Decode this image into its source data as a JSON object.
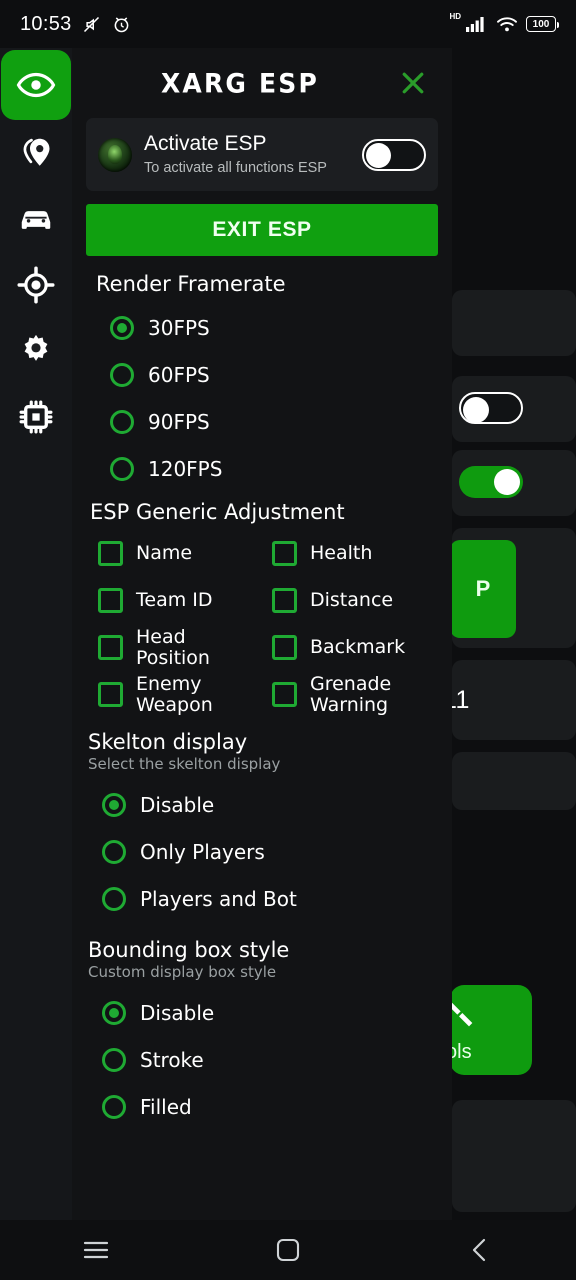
{
  "status_bar": {
    "clock": "10:53",
    "battery_percent": "100",
    "network_label": "HD",
    "wifi_gen": "6",
    "icons": [
      "mute-icon",
      "alarm-icon",
      "cellular-signal-icon",
      "wifi-icon",
      "battery-icon"
    ]
  },
  "header": {
    "title": "XARG ESP",
    "eye_icon": "eye-icon",
    "close_icon": "close-icon",
    "accent": "#10a010"
  },
  "sidebar": {
    "items": [
      {
        "name": "sidebar-item-location",
        "icon": "location-pin-icon"
      },
      {
        "name": "sidebar-item-vehicle",
        "icon": "car-icon"
      },
      {
        "name": "sidebar-item-aim",
        "icon": "crosshair-target-icon"
      },
      {
        "name": "sidebar-item-settings",
        "icon": "gear-icon"
      },
      {
        "name": "sidebar-item-memory",
        "icon": "cpu-chip-icon"
      }
    ]
  },
  "activate_card": {
    "title": "Activate ESP",
    "subtitle": "To activate all functions ESP",
    "toggle_state": "off",
    "avatar": "app-avatar-icon"
  },
  "exit_button": {
    "label": "EXIT ESP"
  },
  "render_framerate": {
    "heading": "Render Framerate",
    "options": [
      {
        "label": "30FPS",
        "selected": true
      },
      {
        "label": "60FPS",
        "selected": false
      },
      {
        "label": "90FPS",
        "selected": false
      },
      {
        "label": "120FPS",
        "selected": false
      }
    ]
  },
  "esp_generic_adjustment": {
    "heading": "ESP Generic Adjustment",
    "checkboxes": [
      {
        "label": "Name",
        "checked": false
      },
      {
        "label": "Health",
        "checked": false
      },
      {
        "label": "Team ID",
        "checked": false
      },
      {
        "label": "Distance",
        "checked": false
      },
      {
        "label": "Head Position",
        "checked": false
      },
      {
        "label": "Backmark",
        "checked": false
      },
      {
        "label": "Enemy Weapon",
        "checked": false
      },
      {
        "label": "Grenade Warning",
        "checked": false
      }
    ]
  },
  "skelton_display": {
    "heading": "Skelton display",
    "subtitle": "Select the skelton display",
    "options": [
      {
        "label": "Disable",
        "selected": true
      },
      {
        "label": "Only Players",
        "selected": false
      },
      {
        "label": "Players and Bot",
        "selected": false
      }
    ]
  },
  "bounding_box_style": {
    "heading": "Bounding box style",
    "subtitle": "Custom display box style",
    "options": [
      {
        "label": "Disable",
        "selected": true
      },
      {
        "label": "Stroke",
        "selected": false
      },
      {
        "label": "Filled",
        "selected": false
      }
    ]
  },
  "background_layer": {
    "partial_text": "11",
    "partial_button_label": "P",
    "partial_tile_label": "ols",
    "toggles": [
      {
        "state": "off"
      },
      {
        "state": "on"
      }
    ]
  },
  "nav_bar": {
    "buttons": [
      {
        "name": "nav-recents-button",
        "icon": "menu-lines-icon"
      },
      {
        "name": "nav-home-button",
        "icon": "square-icon"
      },
      {
        "name": "nav-back-button",
        "icon": "chevron-left-icon"
      }
    ]
  }
}
